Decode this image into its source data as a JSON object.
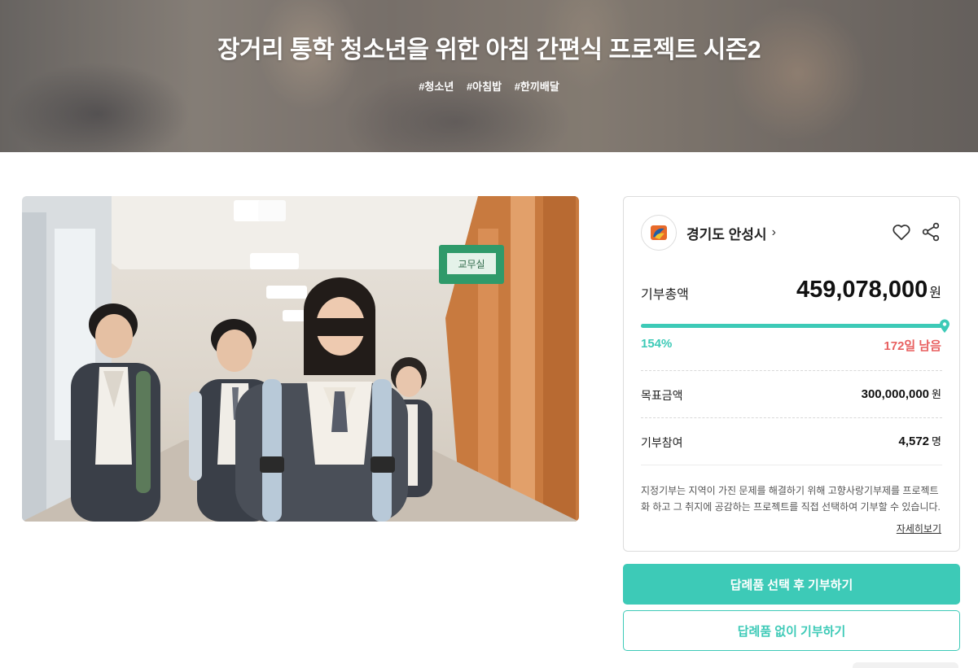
{
  "hero": {
    "title": "장거리 통학 청소년을 위한 아침 간편식 프로젝트 시즌2",
    "tags": [
      "#청소년",
      "#아침밥",
      "#한끼배달"
    ]
  },
  "photo": {
    "sign_text": "교무실"
  },
  "card": {
    "org_name": "경기도 안성시",
    "total_label": "기부총액",
    "total_amount": "459,078,000",
    "total_unit": "원",
    "progress_percent": 100,
    "percent_label": "154%",
    "remaining_label": "172일 남음",
    "goal_label": "목표금액",
    "goal_amount": "300,000,000",
    "goal_unit": "원",
    "participants_label": "기부참여",
    "participants_count": "4,572",
    "participants_unit": "명",
    "notice": "지정기부는 지역이 가진 문제를 해결하기 위해 고향사랑기부제를 프로젝트화 하고 그 취지에 공감하는 프로젝트를 직접 선택하여 기부할 수 있습니다.",
    "more_link": "자세히보기"
  },
  "buttons": {
    "primary": "답례품 선택 후 기부하기",
    "secondary": "답례품 없이 기부하기"
  },
  "colors": {
    "accent": "#3dcab7",
    "alert": "#e86060"
  }
}
